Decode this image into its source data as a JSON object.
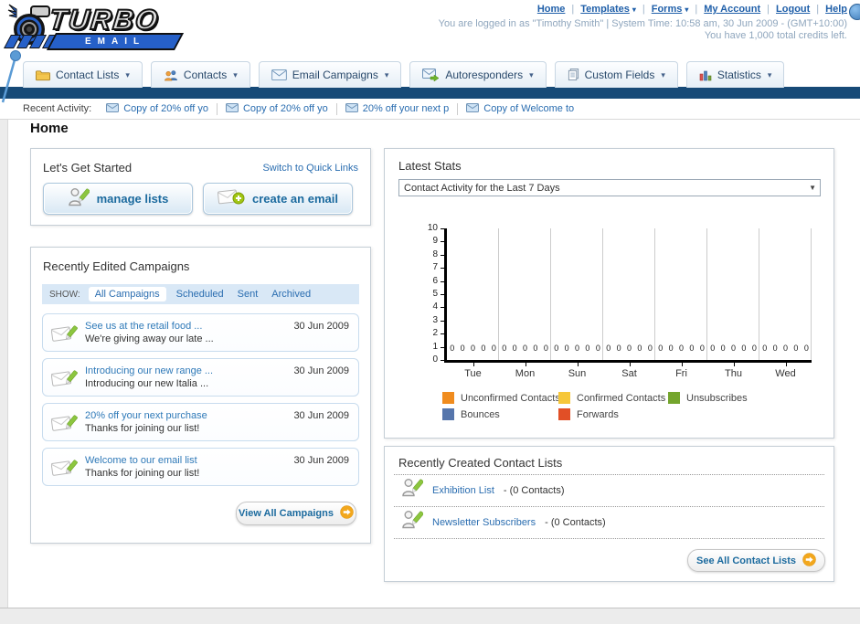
{
  "header": {
    "logo": {
      "title": "TURBO",
      "subtitle": "EMAIL"
    },
    "nav_links": [
      {
        "label": "Home",
        "dropdown": false
      },
      {
        "label": "Templates",
        "dropdown": true
      },
      {
        "label": "Forms",
        "dropdown": true
      },
      {
        "label": "My Account",
        "dropdown": false
      },
      {
        "label": "Logout",
        "dropdown": false
      },
      {
        "label": "Help",
        "dropdown": false
      }
    ],
    "session_line": "You are logged in as \"Timothy Smith\" | System Time: 10:58 am, 30 Jun 2009 - (GMT+10:00)",
    "credits_line": "You have 1,000 total credits left."
  },
  "nav_tabs": [
    {
      "label": "Contact Lists",
      "icon": "contact-lists-folder-icon"
    },
    {
      "label": "Contacts",
      "icon": "contacts-people-icon"
    },
    {
      "label": "Email Campaigns",
      "icon": "email-envelope-icon"
    },
    {
      "label": "Autoresponders",
      "icon": "autoresponder-envelope-icon"
    },
    {
      "label": "Custom Fields",
      "icon": "custom-fields-pages-icon"
    },
    {
      "label": "Statistics",
      "icon": "statistics-bars-icon"
    }
  ],
  "recent_activity": {
    "label": "Recent Activity:",
    "items": [
      {
        "label": "Copy of 20% off yo",
        "icon": "small-envelope-icon"
      },
      {
        "label": "Copy of 20% off yo",
        "icon": "small-envelope-icon"
      },
      {
        "label": "20% off your next p",
        "icon": "small-envelope-icon"
      },
      {
        "label": "Copy of Welcome to",
        "icon": "small-envelope-icon"
      }
    ]
  },
  "page_title": "Home",
  "get_started": {
    "title": "Let's Get Started",
    "switch_link": "Switch to Quick Links",
    "buttons": [
      {
        "label": "manage lists",
        "icon": "person-edit-icon"
      },
      {
        "label": "create an email",
        "icon": "envelope-plus-icon"
      }
    ]
  },
  "campaigns": {
    "title": "Recently Edited Campaigns",
    "show_label": "SHOW:",
    "filters": [
      "All Campaigns",
      "Scheduled",
      "Sent",
      "Archived"
    ],
    "active_filter": "All Campaigns",
    "rows": [
      {
        "title": "See us at the retail food ...",
        "subtitle": "We're giving away our late ...",
        "date": "30 Jun 2009",
        "icon": "envelope-edit-icon"
      },
      {
        "title": "Introducing our new range ...",
        "subtitle": "Introducing our new Italia ...",
        "date": "30 Jun 2009",
        "icon": "envelope-edit-icon"
      },
      {
        "title": "20% off your next purchase",
        "subtitle": "Thanks for joining our list!",
        "date": "30 Jun 2009",
        "icon": "envelope-edit-icon"
      },
      {
        "title": "Welcome to our email list",
        "subtitle": "Thanks for joining our list!",
        "date": "30 Jun 2009",
        "icon": "envelope-edit-icon"
      }
    ],
    "view_all_label": "View All Campaigns"
  },
  "latest_stats": {
    "title": "Latest Stats",
    "dropdown_value": "Contact Activity for the Last 7 Days"
  },
  "chart_data": {
    "type": "bar",
    "title": "Contact Activity for the Last 7 Days",
    "categories": [
      "Tue",
      "Mon",
      "Sun",
      "Sat",
      "Fri",
      "Thu",
      "Wed"
    ],
    "series": [
      {
        "name": "Unconfirmed Contacts",
        "color": "#f08c1e",
        "values": [
          0,
          0,
          0,
          0,
          0,
          0,
          0
        ]
      },
      {
        "name": "Confirmed Contacts",
        "color": "#f6c73a",
        "values": [
          0,
          0,
          0,
          0,
          0,
          0,
          0
        ]
      },
      {
        "name": "Unsubscribes",
        "color": "#74a52d",
        "values": [
          0,
          0,
          0,
          0,
          0,
          0,
          0
        ]
      },
      {
        "name": "Bounces",
        "color": "#5676ac",
        "values": [
          0,
          0,
          0,
          0,
          0,
          0,
          0
        ]
      },
      {
        "name": "Forwards",
        "color": "#e14f26",
        "values": [
          0,
          0,
          0,
          0,
          0,
          0,
          0
        ]
      }
    ],
    "xlabel": "",
    "ylabel": "",
    "ylim": [
      0,
      10
    ],
    "yticks": [
      0,
      1,
      2,
      3,
      4,
      5,
      6,
      7,
      8,
      9,
      10
    ],
    "grid": "vertical-only",
    "legend_position": "bottom",
    "value_labels_shown": true
  },
  "contact_lists": {
    "title": "Recently Created Contact Lists",
    "items": [
      {
        "name": "Exhibition List",
        "detail": "- (0 Contacts)",
        "icon": "person-edit-icon"
      },
      {
        "name": "Newsletter Subscribers",
        "detail": "- (0 Contacts)",
        "icon": "person-edit-icon"
      }
    ],
    "see_all_label": "See All Contact Lists"
  },
  "colors": {
    "navy_bar": "#174a77",
    "link_blue": "#2a6db0",
    "button_text_blue": "#1b6a9e",
    "accent_orange": "#f2a71d",
    "logo_blue": "#2660c8"
  }
}
